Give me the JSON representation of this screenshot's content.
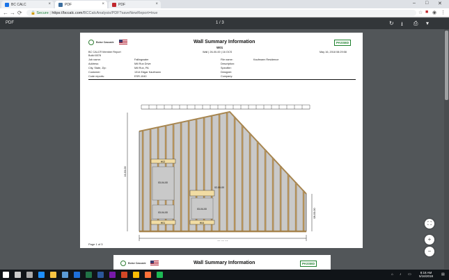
{
  "browser": {
    "tabs": [
      {
        "title": "BC CALC",
        "color": "#1a73e8"
      },
      {
        "title": "PDF",
        "color": "#3c6e9e"
      },
      {
        "title": "PDF",
        "color": "#c1272d"
      }
    ],
    "secure_label": "Secure",
    "url_host": "https://bccalc.com",
    "url_path": "/BCCalcAnalysis/PDF?saveNewReport=true",
    "window_controls": [
      "–",
      "□",
      "✕"
    ]
  },
  "pdf_toolbar": {
    "title": "PDF",
    "page_indicator": "1  /  3"
  },
  "page1": {
    "brand": "Boise Cascade",
    "title": "Wall Summary Information",
    "wall_id": "W01",
    "wall_spec": "Wall | 26-00-00 | 16 OCS",
    "status": "PASSED",
    "report_name": "BC CALC® Member Report",
    "build": "Build 6578",
    "date": "May 16, 2018 08:29:58",
    "left_fields": [
      {
        "label": "Job name:",
        "value": "Fallingwater"
      },
      {
        "label": "Address:",
        "value": "Mill Run Drive"
      },
      {
        "label": "City, State, Zip:",
        "value": "Mill Run, PA"
      },
      {
        "label": "Customer:",
        "value": "1314 Edgar Kaufmann"
      },
      {
        "label": "Code reports:",
        "value": "ESR-1040"
      }
    ],
    "right_fields": [
      {
        "label": "File name:",
        "value": "Kaufmann Residence"
      },
      {
        "label": "Description:",
        "value": ""
      },
      {
        "label": "Specifier:",
        "value": ""
      },
      {
        "label": "Designer:",
        "value": ""
      },
      {
        "label": "Company:",
        "value": ""
      }
    ],
    "drawing": {
      "header_labels": [
        "H02",
        "H01",
        "H04"
      ],
      "opening_labels": [
        "03-04-00",
        "03-04-00",
        "03-04-00"
      ],
      "dim_left": "16-03-00",
      "dim_right": "08-03-00",
      "dim_bottom": "26-00-00",
      "dim_opening": "02-00-00"
    },
    "footer": "Page 1 of 3"
  },
  "page2": {
    "brand": "Boise Cascade",
    "title": "Wall Summary Information",
    "status": "PASSED"
  },
  "zoom_controls": {
    "fit": "⛶",
    "zoom_in": "+",
    "zoom_out": "−"
  },
  "taskbar": {
    "time": "8:18 AM",
    "date": "5/16/2018",
    "apps": [
      {
        "name": "start",
        "color": "#ffffff"
      },
      {
        "name": "search",
        "color": "#cccccc"
      },
      {
        "name": "task-view",
        "color": "#aaaaaa"
      },
      {
        "name": "edge",
        "color": "#1e90ff"
      },
      {
        "name": "file-explorer",
        "color": "#f5c342"
      },
      {
        "name": "store",
        "color": "#5b9bd5"
      },
      {
        "name": "mail",
        "color": "#1e6fd9"
      },
      {
        "name": "excel",
        "color": "#217346"
      },
      {
        "name": "word",
        "color": "#2b579a"
      },
      {
        "name": "onenote",
        "color": "#7719aa"
      },
      {
        "name": "powerpoint",
        "color": "#d24726"
      },
      {
        "name": "chrome",
        "color": "#fbbc05"
      },
      {
        "name": "firefox",
        "color": "#ff7139"
      },
      {
        "name": "spotify",
        "color": "#1db954"
      }
    ]
  }
}
